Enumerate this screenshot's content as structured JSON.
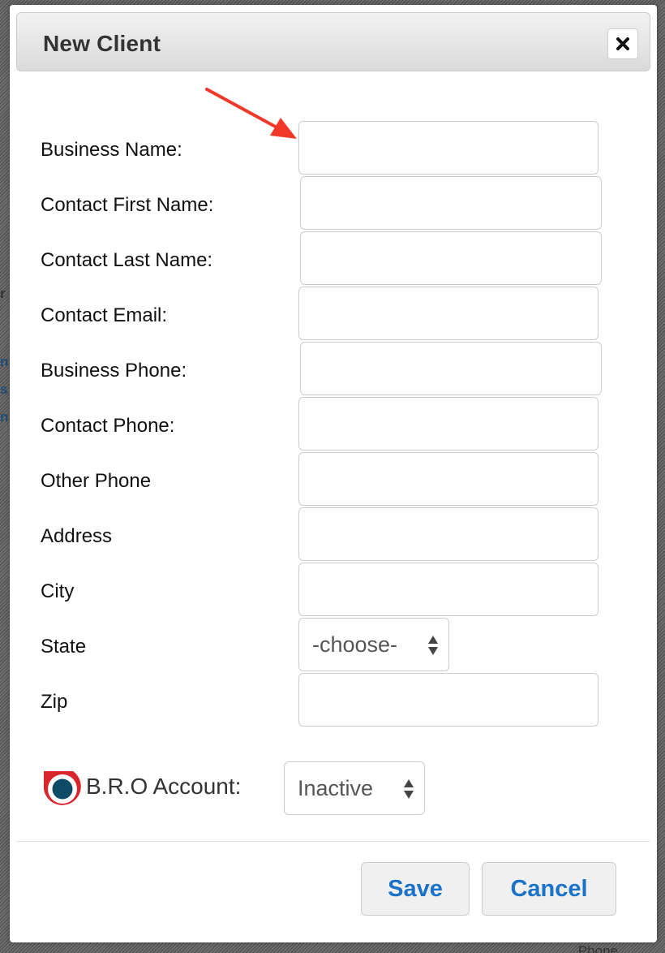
{
  "dialog": {
    "title": "New Client",
    "close_symbol": "✖",
    "close_icon": "close-icon"
  },
  "form": {
    "fields": [
      {
        "label": "Business Name:",
        "value": ""
      },
      {
        "label": "Contact First Name:",
        "value": ""
      },
      {
        "label": "Contact Last Name:",
        "value": ""
      },
      {
        "label": "Contact Email:",
        "value": ""
      },
      {
        "label": "Business Phone:",
        "value": ""
      },
      {
        "label": "Contact Phone:",
        "value": ""
      },
      {
        "label": "Other Phone",
        "value": ""
      },
      {
        "label": "Address",
        "value": ""
      },
      {
        "label": "City",
        "value": ""
      }
    ],
    "state": {
      "label": "State",
      "selected": "-choose-"
    },
    "zip": {
      "label": "Zip",
      "value": ""
    },
    "bro_account": {
      "label": "B.R.O Account:",
      "selected": "Inactive",
      "icon": "bro-logo-icon"
    }
  },
  "buttons": {
    "save": "Save",
    "cancel": "Cancel"
  },
  "annotation": {
    "icon": "red-arrow-icon",
    "color": "#f2382a"
  },
  "colors": {
    "button_text": "#1a73c8",
    "bro_ring": "#d9262c",
    "bro_center": "#0d4a66"
  }
}
